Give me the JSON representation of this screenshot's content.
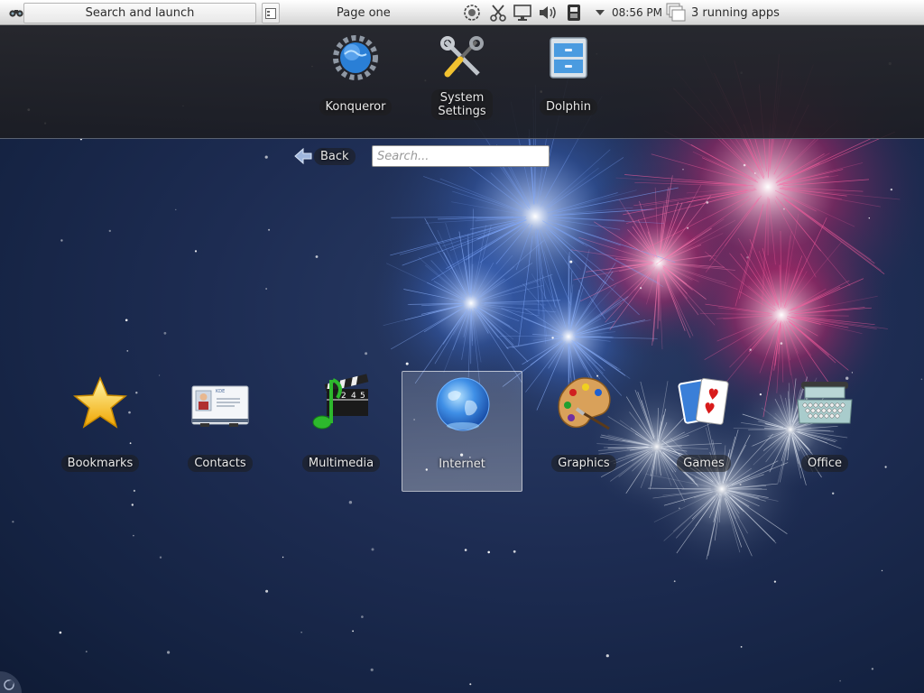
{
  "panel": {
    "search_launch_label": "Search and launch",
    "page_label": "Page one",
    "clock": "08:56 PM",
    "running_apps": "3 running apps",
    "tray_icons": [
      "notifier-icon",
      "klipper-scissors-icon",
      "display-icon",
      "volume-icon",
      "printer-icon",
      "tray-expand-icon"
    ]
  },
  "favorites": [
    {
      "label": "Konqueror",
      "icon": "konqueror-icon"
    },
    {
      "label": "System\nSettings",
      "icon": "system-settings-icon"
    },
    {
      "label": "Dolphin",
      "icon": "dolphin-icon"
    }
  ],
  "nav": {
    "back_label": "Back",
    "search_placeholder": "Search..."
  },
  "categories": [
    {
      "label": "Bookmarks",
      "icon": "star-icon"
    },
    {
      "label": "Contacts",
      "icon": "contact-card-icon"
    },
    {
      "label": "Multimedia",
      "icon": "multimedia-icon"
    },
    {
      "label": "Internet",
      "icon": "globe-icon",
      "selected": true
    },
    {
      "label": "Graphics",
      "icon": "palette-icon"
    },
    {
      "label": "Games",
      "icon": "playing-cards-icon"
    },
    {
      "label": "Office",
      "icon": "typewriter-icon"
    }
  ],
  "contact_card_text": "KDE",
  "clapper_digits": [
    "2",
    "4",
    "5"
  ]
}
